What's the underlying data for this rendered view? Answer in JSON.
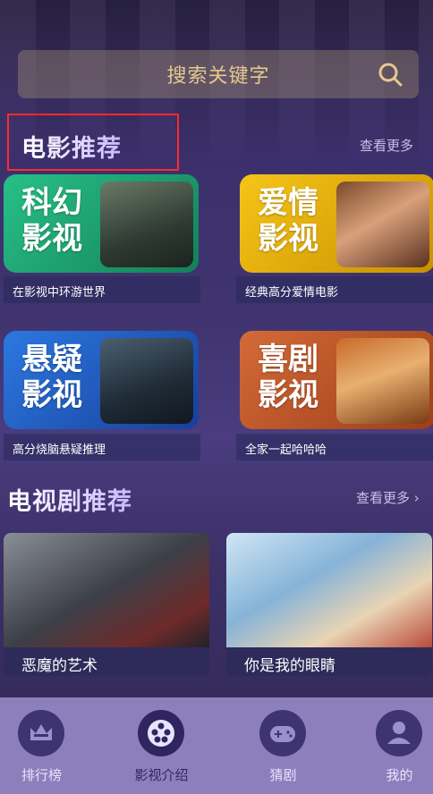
{
  "search": {
    "placeholder": "搜索关键字"
  },
  "movies": {
    "title": "电影推荐",
    "more": "查看更多",
    "cards": [
      {
        "label_line1": "科幻",
        "label_line2": "影视",
        "subtitle": "在影视中环游世界",
        "color": "#1fa36f"
      },
      {
        "label_line1": "爱情",
        "label_line2": "影视",
        "subtitle": "经典高分爱情电影",
        "color": "#d9a400"
      },
      {
        "label_line1": "悬疑",
        "label_line2": "影视",
        "subtitle": "高分烧脑悬疑推理",
        "color": "#1b56b8"
      },
      {
        "label_line1": "喜剧",
        "label_line2": "影视",
        "subtitle": "全家一起哈哈哈",
        "color": "#c05a2b"
      }
    ]
  },
  "tv": {
    "title": "电视剧推荐",
    "more": "查看更多",
    "items": [
      {
        "caption": "恶魔的艺术"
      },
      {
        "caption": "你是我的眼睛"
      }
    ]
  },
  "tabs": [
    {
      "label": "排行榜",
      "icon": "crown-icon"
    },
    {
      "label": "影视介绍",
      "icon": "film-reel-icon"
    },
    {
      "label": "猜剧",
      "icon": "gamepad-icon"
    },
    {
      "label": "我的",
      "icon": "user-icon"
    }
  ]
}
